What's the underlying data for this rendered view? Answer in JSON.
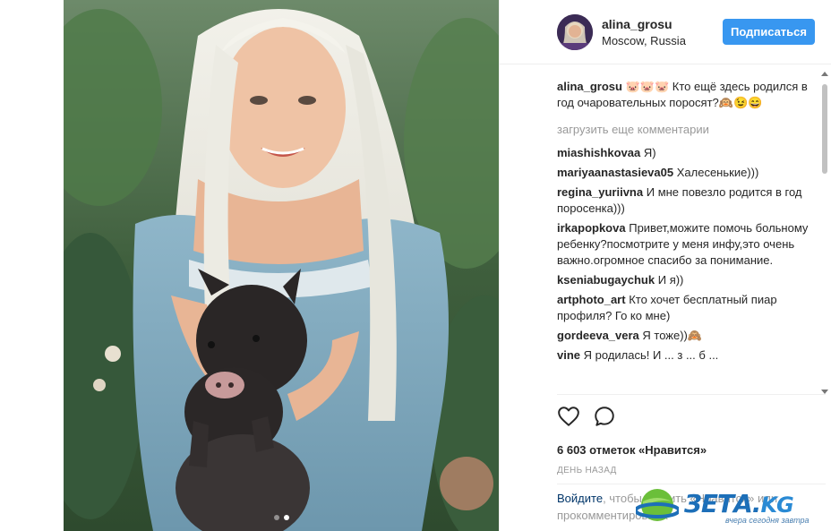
{
  "post": {
    "username": "alina_grosu",
    "location": "Moscow, Russia",
    "follow_label": "Подписаться",
    "caption_user": "alina_grosu",
    "caption_text": "🐷🐷🐷 Кто ещё здесь родился в год очаровательных поросят?🙉😉😄",
    "load_more": "загрузить еще комментарии",
    "comments": [
      {
        "user": "miashishkovaa",
        "text": "Я)"
      },
      {
        "user": "mariyaanastasieva05",
        "text": "Халесенькие)))"
      },
      {
        "user": "regina_yuriivna",
        "text": "И мне повезло родится в год поросенка)))"
      },
      {
        "user": "irkapopkova",
        "text": "Привет,можите помочь больному ребенку?посмотрите у меня инфу,это очень важно.огромное спасибо за понимание."
      },
      {
        "user": "kseniabugaychuk",
        "text": "И я))"
      },
      {
        "user": "artphoto_art",
        "text": "Кто хочет бесплатный пиар профиля? Го ко мне)"
      },
      {
        "user": "gordeeva_vera",
        "text": "Я тоже))🙈"
      },
      {
        "user": "vine",
        "text": "Я родилась! И ... з ... б ..."
      }
    ],
    "likes": "6 603 отметок «Нравится»",
    "date": "ДЕНЬ НАЗАД",
    "login_link": "Войдите",
    "login_text": ", чтобы ставить «Нравится» или прокомментировать."
  },
  "watermark": {
    "brand": "ЗЕТА.",
    "tld": "KG",
    "tagline": "вчера сегодня завтра"
  },
  "colors": {
    "accent": "#3897f0",
    "link": "#003569",
    "muted": "#999999"
  },
  "icons": [
    "heart-icon",
    "comment-icon"
  ]
}
